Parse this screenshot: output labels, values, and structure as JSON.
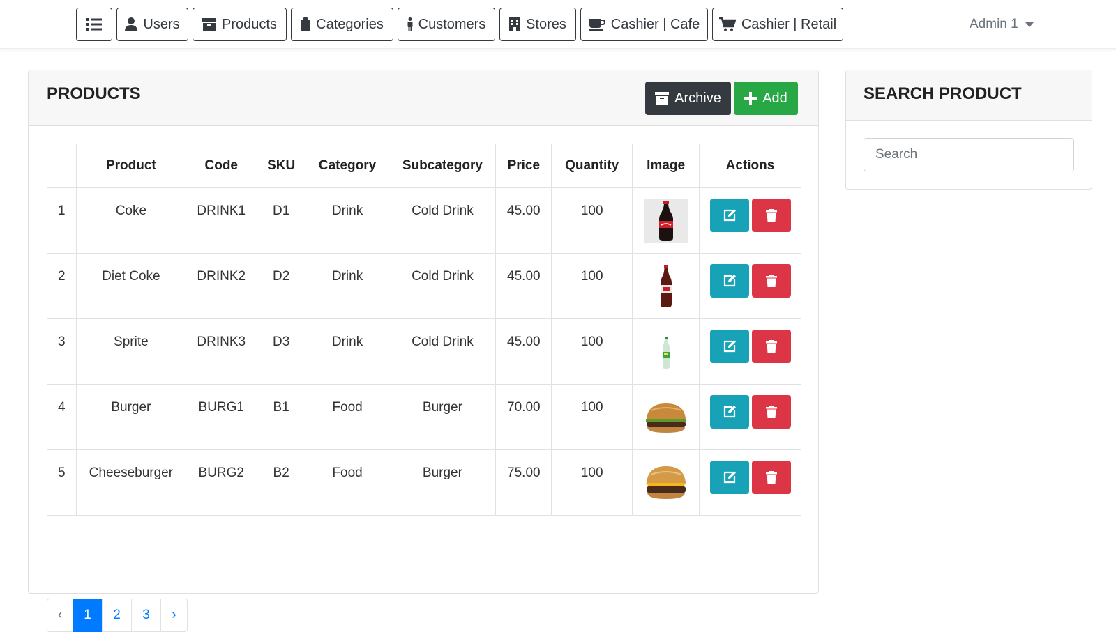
{
  "navbar": {
    "menu_icon": "list-icon",
    "items": [
      {
        "label": "Users",
        "icon": "user-icon"
      },
      {
        "label": "Products",
        "icon": "box-icon"
      },
      {
        "label": "Categories",
        "icon": "clipboard-icon"
      },
      {
        "label": "Customers",
        "icon": "person-icon"
      },
      {
        "label": "Stores",
        "icon": "building-icon"
      },
      {
        "label": "Cashier | Cafe",
        "icon": "coffee-icon"
      },
      {
        "label": "Cashier | Retail",
        "icon": "cart-icon"
      }
    ],
    "user_menu": "Admin 1"
  },
  "products_card": {
    "title": "PRODUCTS",
    "archive_label": "Archive",
    "add_label": "Add"
  },
  "table": {
    "headers": [
      "",
      "Product",
      "Code",
      "SKU",
      "Category",
      "Subcategory",
      "Price",
      "Quantity",
      "Image",
      "Actions"
    ],
    "rows": [
      {
        "num": "1",
        "product": "Coke",
        "code": "DRINK1",
        "sku": "D1",
        "category": "Drink",
        "subcategory": "Cold Drink",
        "price": "45.00",
        "quantity": "100",
        "image": "coke-bottle"
      },
      {
        "num": "2",
        "product": "Diet Coke",
        "code": "DRINK2",
        "sku": "D2",
        "category": "Drink",
        "subcategory": "Cold Drink",
        "price": "45.00",
        "quantity": "100",
        "image": "diet-coke-bottle"
      },
      {
        "num": "3",
        "product": "Sprite",
        "code": "DRINK3",
        "sku": "D3",
        "category": "Drink",
        "subcategory": "Cold Drink",
        "price": "45.00",
        "quantity": "100",
        "image": "sprite-bottle"
      },
      {
        "num": "4",
        "product": "Burger",
        "code": "BURG1",
        "sku": "B1",
        "category": "Food",
        "subcategory": "Burger",
        "price": "70.00",
        "quantity": "100",
        "image": "burger"
      },
      {
        "num": "5",
        "product": "Cheeseburger",
        "code": "BURG2",
        "sku": "B2",
        "category": "Food",
        "subcategory": "Burger",
        "price": "75.00",
        "quantity": "100",
        "image": "cheeseburger"
      }
    ]
  },
  "pagination": {
    "prev": "‹",
    "pages": [
      "1",
      "2",
      "3"
    ],
    "active": "1",
    "next": "›"
  },
  "search_card": {
    "title": "SEARCH PRODUCT",
    "placeholder": "Search"
  },
  "colors": {
    "archive": "#343a40",
    "add": "#28a745",
    "edit": "#17a2b8",
    "delete": "#dc3545",
    "active_page": "#007bff"
  }
}
